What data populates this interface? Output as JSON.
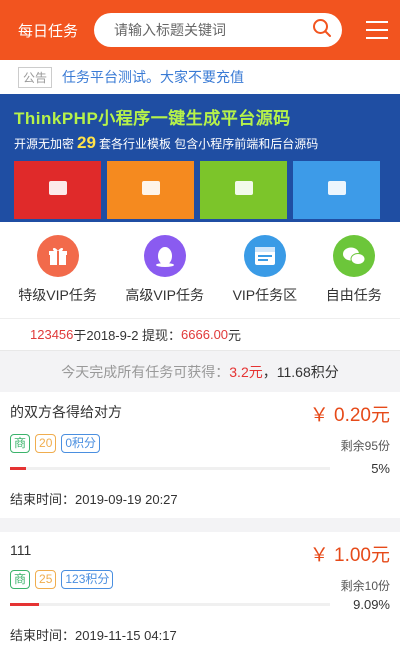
{
  "header": {
    "title": "每日任务",
    "search_placeholder": "请输入标题关键词"
  },
  "notice": {
    "tag": "公告",
    "text": "任务平台测试。大家不要充值"
  },
  "banner": {
    "title": "ThinkPHP小程序一键生成平台源码",
    "sub_before": "开源无加密",
    "sub_num": "29",
    "sub_after": "套各行业模板  包含小程序前端和后台源码",
    "tiles": [
      {
        "color": "#e02a2a"
      },
      {
        "color": "#f58a1f"
      },
      {
        "color": "#7cc52a"
      },
      {
        "color": "#3d9be8"
      }
    ]
  },
  "categories": [
    {
      "label": "特级VIP任务",
      "icon": "gift-icon",
      "color": "#f26a4b"
    },
    {
      "label": "高级VIP任务",
      "icon": "qq-penguin-icon",
      "color": "#8a5bf0"
    },
    {
      "label": "VIP任务区",
      "icon": "browser-window-icon",
      "color": "#3a9be6"
    },
    {
      "label": "自由任务",
      "icon": "wechat-icon",
      "color": "#6cc63a"
    }
  ],
  "withdraw": {
    "user": "123456",
    "mid": " 于2018-9-2 提现：",
    "amount": "6666.00",
    "unit": " 元"
  },
  "summary": {
    "prefix": "今天完成所有任务可获得：",
    "money": "3.2元",
    "sep": "，",
    "points": "11.68积分"
  },
  "tasks": [
    {
      "title": "的双方各得给对方",
      "price": "￥ 0.20元",
      "remain": "剩余95份",
      "badge_type": "商",
      "badge_count": "20",
      "badge_points": "0积分",
      "progress": 0.05,
      "progress_text": "5%",
      "end_time": "结束时间：2019-09-19 20:27"
    },
    {
      "title": "111",
      "price": "￥ 1.00元",
      "remain": "剩余10份",
      "badge_type": "商",
      "badge_count": "25",
      "badge_points": "123积分",
      "progress": 0.0909,
      "progress_text": "9.09%",
      "end_time": "结束时间：2019-11-15 04:17"
    }
  ]
}
